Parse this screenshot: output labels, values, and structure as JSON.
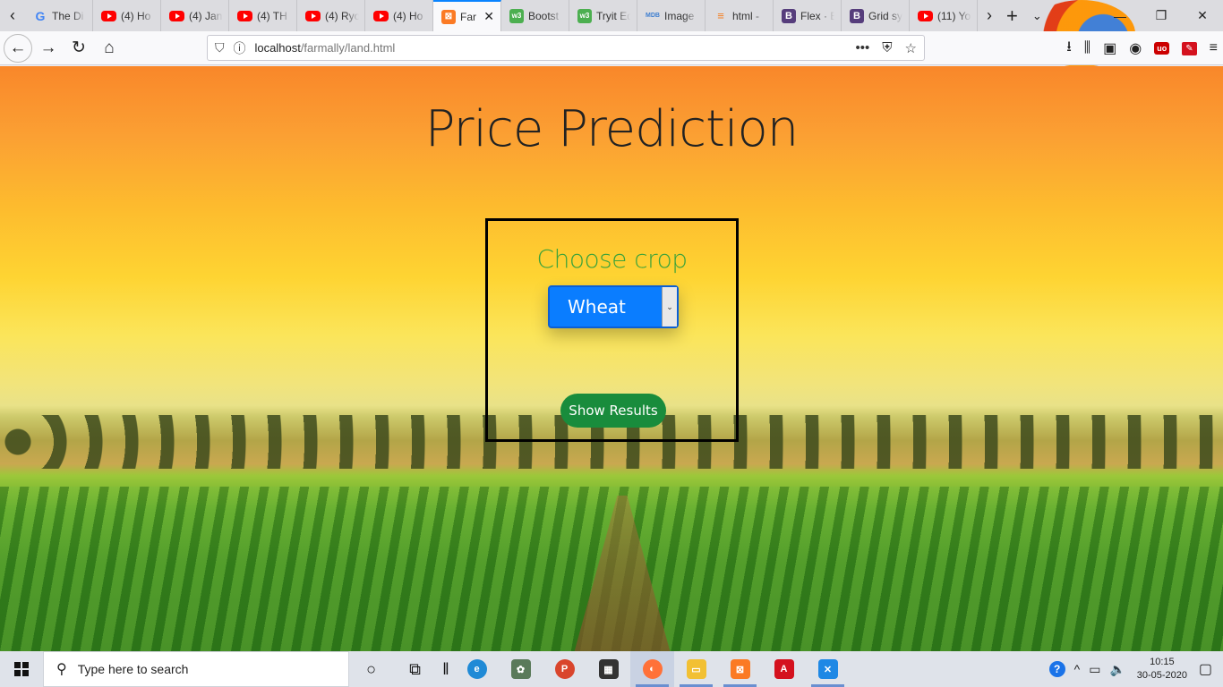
{
  "browser": {
    "tabs": [
      {
        "label": "The Di",
        "icon": "google-icon",
        "fav": "g",
        "glyph": "G"
      },
      {
        "label": "(4) Ho",
        "icon": "youtube-icon",
        "fav": "yt",
        "glyph": ""
      },
      {
        "label": "(4) Jan",
        "icon": "youtube-icon",
        "fav": "yt",
        "glyph": ""
      },
      {
        "label": "(4) TH",
        "icon": "youtube-icon",
        "fav": "yt",
        "glyph": ""
      },
      {
        "label": "(4) Ryo",
        "icon": "youtube-icon",
        "fav": "yt",
        "glyph": ""
      },
      {
        "label": "(4) Ho",
        "icon": "youtube-icon",
        "fav": "yt",
        "glyph": ""
      },
      {
        "label": "Far",
        "icon": "xampp-icon",
        "fav": "xampp",
        "glyph": "⊠",
        "active": true
      },
      {
        "label": "Bootst",
        "icon": "w3schools-icon",
        "fav": "w3",
        "glyph": "w3"
      },
      {
        "label": "Tryit Ed",
        "icon": "w3schools-icon",
        "fav": "w3",
        "glyph": "w3"
      },
      {
        "label": "Image",
        "icon": "mdb-icon",
        "fav": "mdb",
        "glyph": "MDB"
      },
      {
        "label": "html -",
        "icon": "stackoverflow-icon",
        "fav": "so",
        "glyph": "≡"
      },
      {
        "label": "Flex · B",
        "icon": "bootstrap-icon",
        "fav": "bs",
        "glyph": "B"
      },
      {
        "label": "Grid sy",
        "icon": "bootstrap-icon",
        "fav": "bs",
        "glyph": "B"
      },
      {
        "label": "(11) Yo",
        "icon": "youtube-icon",
        "fav": "yt",
        "glyph": ""
      }
    ],
    "url_host": "localhost",
    "url_path": "/farmally/land.html"
  },
  "page": {
    "title": "Price Prediction",
    "card_title": "Choose crop",
    "crop_select_value": "Wheat",
    "show_results_label": "Show Results"
  },
  "taskbar": {
    "search_placeholder": "Type here to search",
    "time": "10:15",
    "date": "30-05-2020"
  },
  "colors": {
    "select_bg": "#0a7dff",
    "button_bg": "#198c3c",
    "card_title": "#3ca33a"
  }
}
